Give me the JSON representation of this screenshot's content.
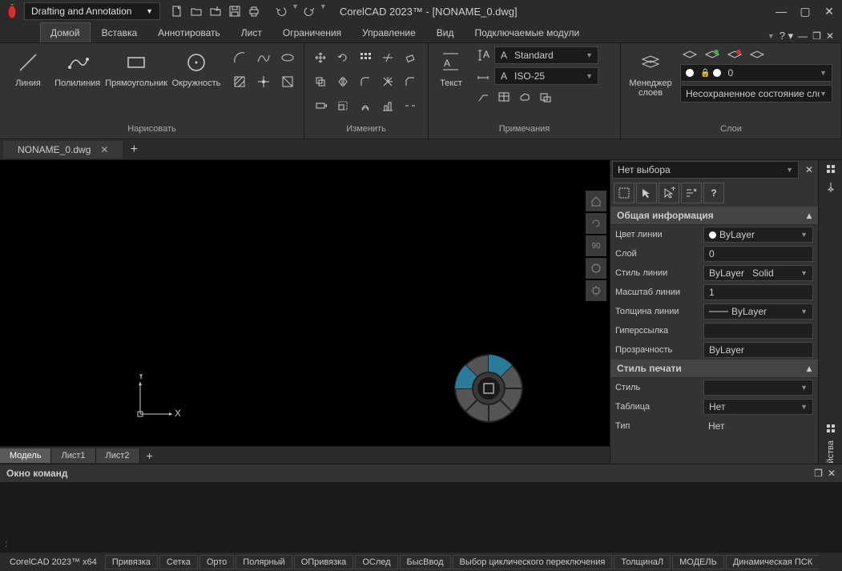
{
  "title_app": "CorelCAD 2023™ - [NONAME_0.dwg]",
  "workspace": "Drafting and Annotation",
  "tabs": {
    "home": "Домой",
    "insert": "Вставка",
    "annotate": "Аннотировать",
    "sheet": "Лист",
    "constraints": "Ограничения",
    "manage": "Управление",
    "view": "Вид",
    "plugins": "Подключаемые модули"
  },
  "ribbon": {
    "draw": {
      "title": "Нарисовать",
      "line": "Линия",
      "polyline": "Полилиния",
      "rect": "Прямоугольник",
      "circle": "Окружность"
    },
    "modify": {
      "title": "Изменить"
    },
    "annot": {
      "title": "Примечания",
      "text": "Текст",
      "style_std": "Standard",
      "style_iso": "ISO-25"
    },
    "layers": {
      "title": "Слои",
      "mgr": "Менеджер слоев",
      "cur_layer": "0",
      "state": "Несохраненное состояние слоев"
    }
  },
  "doc_tab": "NONAME_0.dwg",
  "model_tabs": {
    "model": "Модель",
    "sheet1": "Лист1",
    "sheet2": "Лист2"
  },
  "vp_90": "90",
  "props": {
    "no_sel": "Нет выбора",
    "sec_general": "Общая информация",
    "line_color": "Цвет линии",
    "line_color_v": "ByLayer",
    "layer": "Слой",
    "layer_v": "0",
    "line_style": "Стиль линии",
    "line_style_v": "ByLayer",
    "line_style_v2": "Solid",
    "line_scale": "Масштаб линии",
    "line_scale_v": "1",
    "line_weight": "Толщина линии",
    "line_weight_v": "ByLayer",
    "hyperlink": "Гиперссылка",
    "transparency": "Прозрачность",
    "transparency_v": "ByLayer",
    "sec_plot": "Стиль печати",
    "style": "Стиль",
    "table": "Таблица",
    "table_v": "Нет",
    "type": "Тип",
    "type_v": "Нет"
  },
  "rail_label": "Свойства",
  "cmdwin": {
    "title": "Окно команд",
    "prompt": ":"
  },
  "status": {
    "app": "CorelCAD 2023™ x64",
    "snap": "Привязка",
    "grid": "Сетка",
    "ortho": "Орто",
    "polar": "Полярный",
    "osnap": "ОПривязка",
    "otrace": "ОСлед",
    "qinput": "БысВвод",
    "cycle": "Выбор циклического переключения",
    "lweight": "ТолщинаЛ",
    "model": "МОДЕЛЬ",
    "dynucs": "Динамическая ПСК"
  }
}
